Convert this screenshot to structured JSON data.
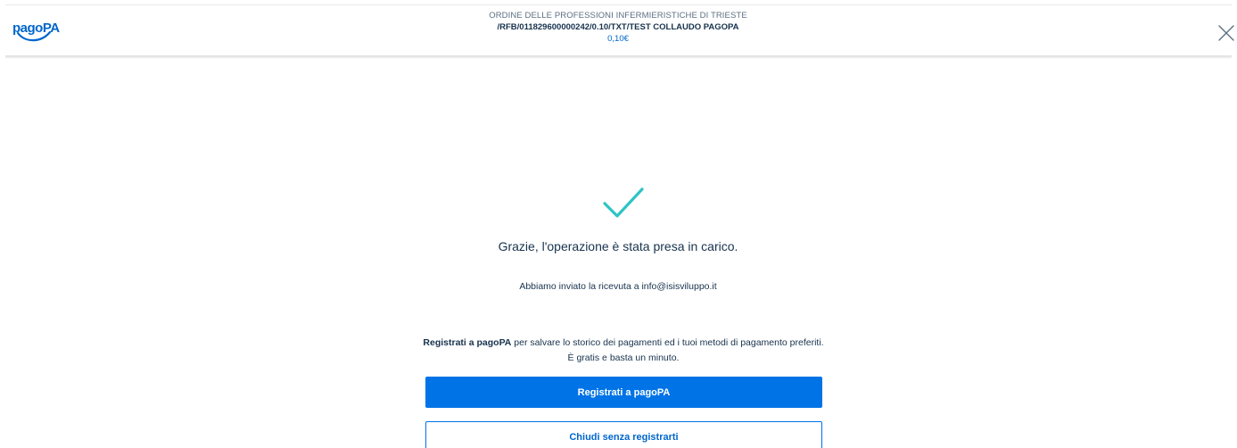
{
  "header": {
    "logo_text": "pagoPA",
    "organization": "ORDINE DELLE PROFESSIONI INFERMIERISTICHE DI TRIESTE",
    "causale": "/RFB/011829600000242/0.10/TXT/TEST COLLAUDO PAGOPA",
    "amount": "0,10€",
    "close_icon": "close-icon"
  },
  "result": {
    "icon": "checkmark-icon",
    "title": "Grazie, l'operazione è stata presa in carico.",
    "receipt_message": "Abbiamo inviato la ricevuta a info@isisviluppo.it"
  },
  "register": {
    "text_bold": "Registrati a pagoPA",
    "text_rest": " per salvare lo storico dei pagamenti ed i tuoi metodi di pagamento preferiti. È gratis e basta un minuto.",
    "primary_button": "Registrati a pagoPA",
    "secondary_button": "Chiudi senza registrarti"
  },
  "colors": {
    "brand_blue": "#0066cc",
    "button_blue": "#0073e6",
    "check_teal": "#2ec4c4",
    "text_dark": "#17324d"
  }
}
